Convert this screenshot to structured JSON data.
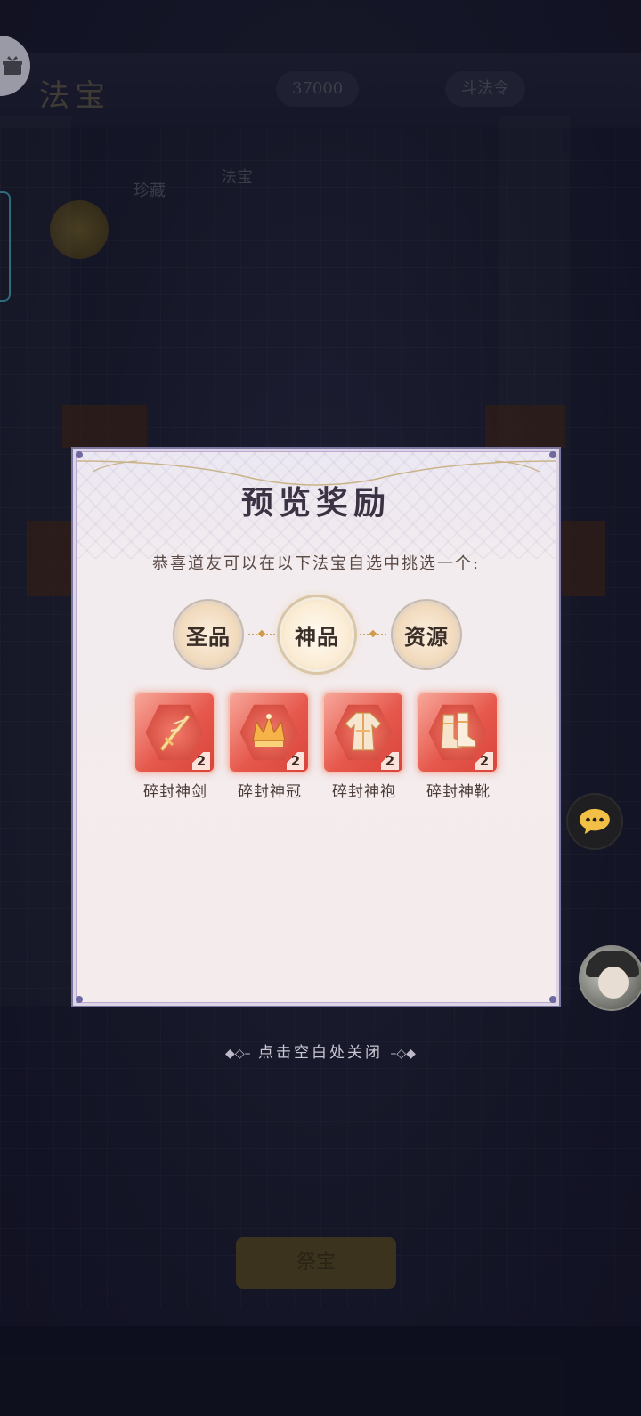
{
  "background": {
    "title": "法宝",
    "res_pill_1": "37000",
    "res_pill_2": "斗法令",
    "tab_left": "珍藏",
    "tab_mid": "法宝",
    "bottom_button": "祭宝"
  },
  "modal": {
    "title": "预览奖励",
    "subtitle": "恭喜道友可以在以下法宝自选中挑选一个:",
    "tabs": [
      {
        "label": "圣品",
        "active": false
      },
      {
        "label": "神品",
        "active": true
      },
      {
        "label": "资源",
        "active": false
      }
    ],
    "items": [
      {
        "name": "碎封神剑",
        "count": "2",
        "icon": "sword-icon"
      },
      {
        "name": "碎封神冠",
        "count": "2",
        "icon": "crown-icon"
      },
      {
        "name": "碎封神袍",
        "count": "2",
        "icon": "robe-icon"
      },
      {
        "name": "碎封神靴",
        "count": "2",
        "icon": "boots-icon"
      }
    ]
  },
  "close_hint": "点击空白处关闭",
  "colors": {
    "modal_border": "#7a76a0",
    "item_red": "#e6584c",
    "tab_gold": "#e6c7a0"
  }
}
